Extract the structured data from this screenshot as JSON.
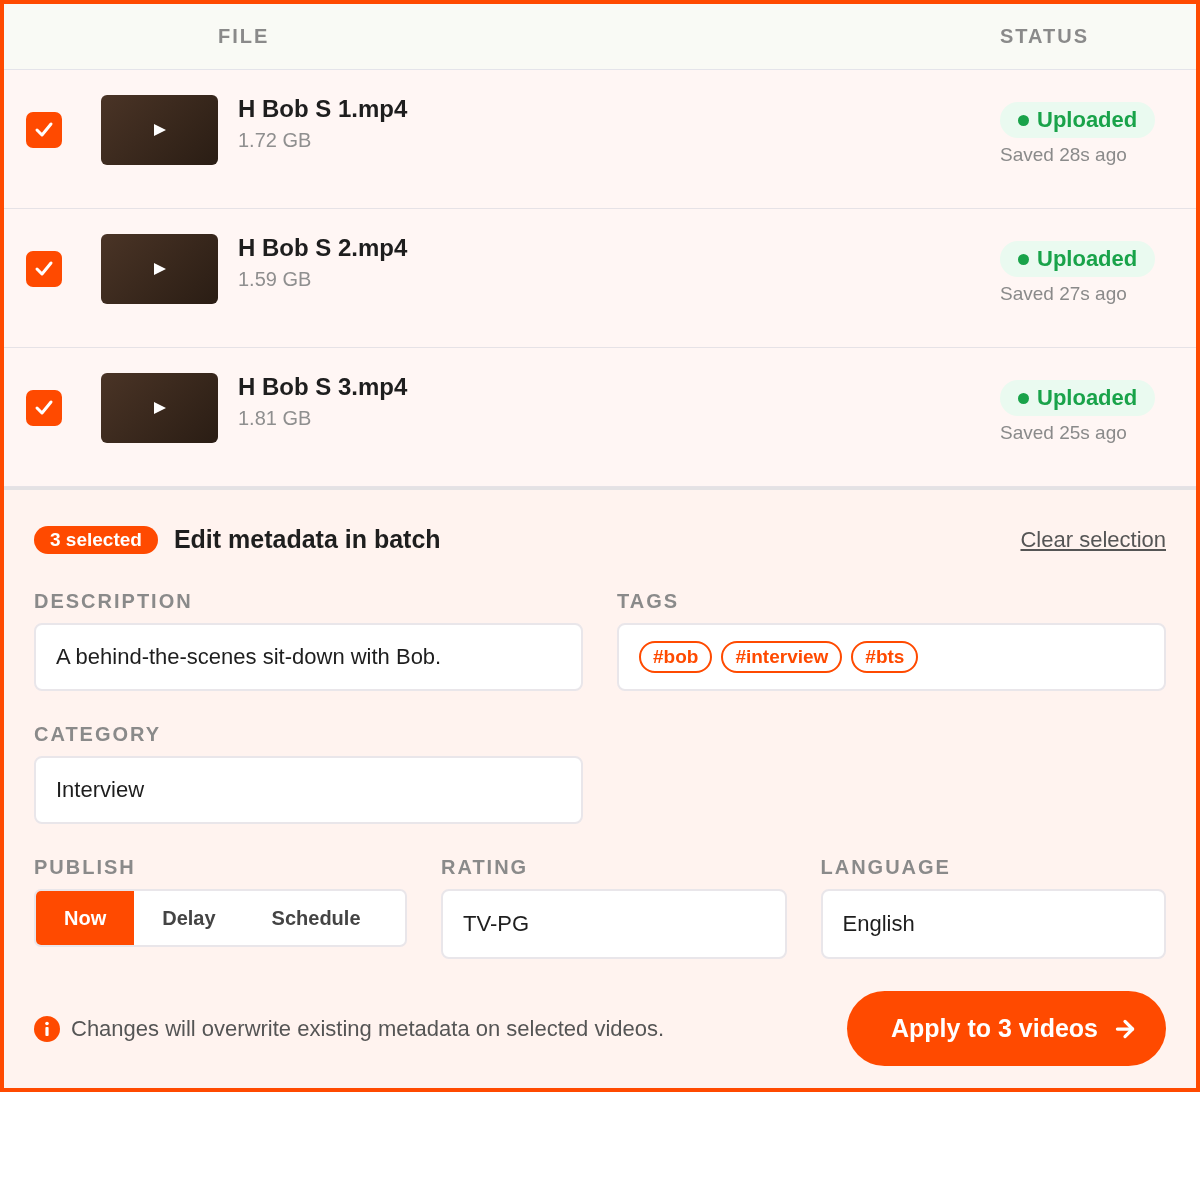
{
  "table": {
    "columns": [
      "FILE",
      "STATUS"
    ],
    "rows": [
      {
        "checked": true,
        "name": "H Bob S 1.mp4",
        "size": "1.72 GB",
        "status": "Uploaded",
        "saved": "Saved 28s ago"
      },
      {
        "checked": true,
        "name": "H Bob S 2.mp4",
        "size": "1.59 GB",
        "status": "Uploaded",
        "saved": "Saved 27s ago"
      },
      {
        "checked": true,
        "name": "H Bob S 3.mp4",
        "size": "1.81 GB",
        "status": "Uploaded",
        "saved": "Saved 25s ago"
      }
    ]
  },
  "batch": {
    "badge": "3 selected",
    "title": "Edit metadata in batch",
    "clear": "Clear selection",
    "description": {
      "label": "DESCRIPTION",
      "value": "A behind-the-scenes sit-down with Bob."
    },
    "tags": {
      "label": "TAGS",
      "items": [
        "#bob",
        "#interview",
        "#bts"
      ]
    },
    "category": {
      "label": "CATEGORY",
      "value": "Interview"
    },
    "publish": {
      "label": "PUBLISH",
      "options": [
        {
          "label": "Now",
          "selected": true
        },
        {
          "label": "Delay",
          "selected": false
        },
        {
          "label": "Schedule",
          "selected": false
        }
      ]
    },
    "rating": {
      "label": "RATING",
      "value": "TV-PG"
    },
    "language": {
      "label": "LANGUAGE",
      "value": "English"
    },
    "note": "Changes will overwrite existing metadata on selected videos.",
    "apply": "Apply to 3 videos"
  }
}
